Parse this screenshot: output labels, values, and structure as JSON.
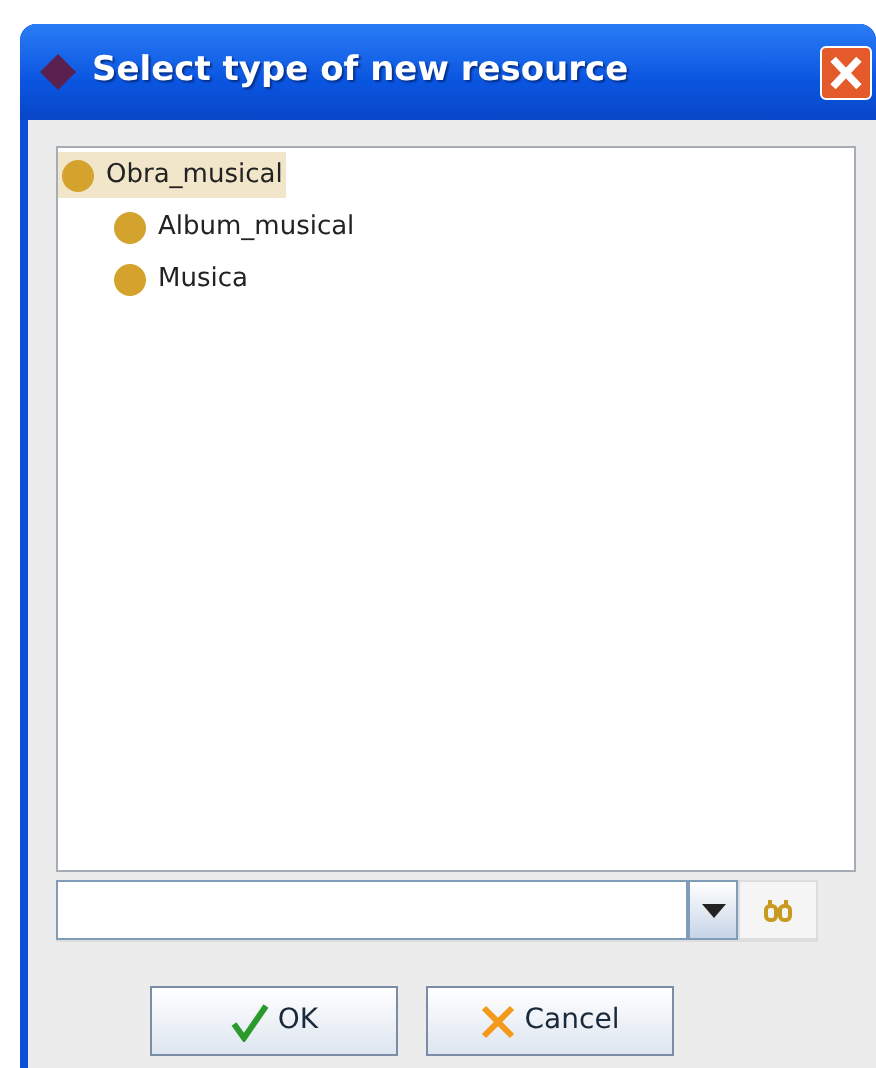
{
  "window": {
    "title": "Select type of new resource"
  },
  "tree": [
    {
      "label": "Obra_musical",
      "selected": true,
      "children": [
        {
          "label": "Album_musical",
          "selected": false
        },
        {
          "label": "Musica",
          "selected": false
        }
      ]
    }
  ],
  "buttons": [
    {
      "label": "OK",
      "kind": "ok"
    },
    {
      "label": "Cancel",
      "kind": "cancel"
    }
  ]
}
